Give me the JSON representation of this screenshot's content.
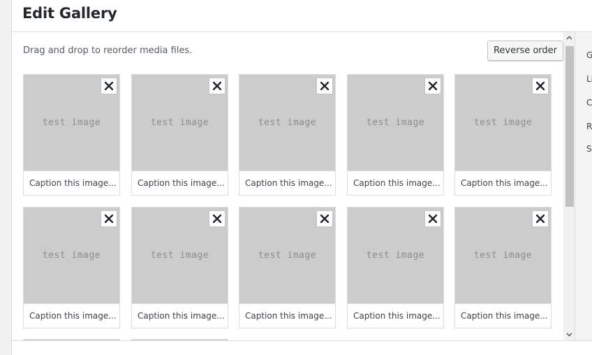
{
  "frame": {
    "title": "Edit Gallery"
  },
  "toolbar": {
    "instructions": "Drag and drop to reorder media files.",
    "reverse_label": "Reverse order"
  },
  "attachments": [
    {
      "label": "test image",
      "caption_placeholder": "Caption this image..."
    },
    {
      "label": "test image",
      "caption_placeholder": "Caption this image..."
    },
    {
      "label": "test image",
      "caption_placeholder": "Caption this image..."
    },
    {
      "label": "test image",
      "caption_placeholder": "Caption this image..."
    },
    {
      "label": "test image",
      "caption_placeholder": "Caption this image..."
    },
    {
      "label": "test image",
      "caption_placeholder": "Caption this image..."
    },
    {
      "label": "test image",
      "caption_placeholder": "Caption this image..."
    },
    {
      "label": "test image",
      "caption_placeholder": "Caption this image..."
    },
    {
      "label": "test image",
      "caption_placeholder": "Caption this image..."
    },
    {
      "label": "test image",
      "caption_placeholder": "Caption this image..."
    }
  ],
  "sidebar": {
    "items": [
      "Ga",
      "Li",
      "C",
      "Ra",
      "Si"
    ]
  },
  "icons": {
    "remove": "close-icon",
    "scroll_up": "chevron-up-icon",
    "scroll_down": "chevron-down-icon"
  }
}
